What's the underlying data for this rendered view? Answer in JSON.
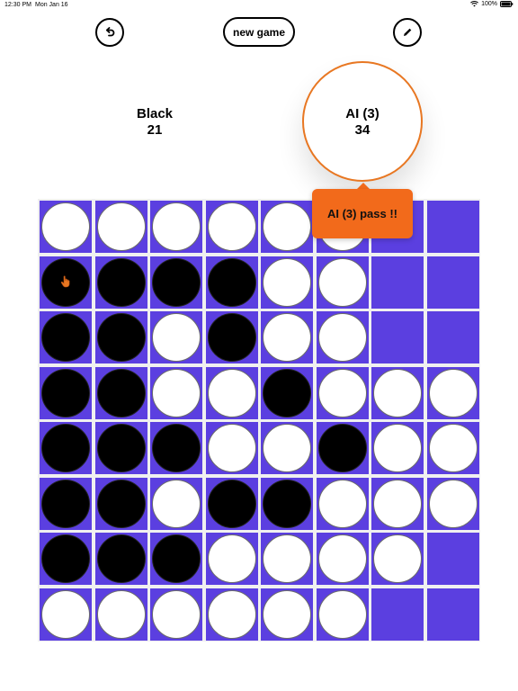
{
  "status_bar": {
    "time": "12:30 PM",
    "date": "Mon Jan 16",
    "battery": "100%"
  },
  "toolbar": {
    "new_game_label": "new game",
    "undo_icon": "undo-icon",
    "edit_icon": "pencil-icon"
  },
  "scores": {
    "black": {
      "name": "Black",
      "count": "21"
    },
    "ai": {
      "name": "AI (3)",
      "count": "34"
    }
  },
  "tooltip": {
    "text": "AI (3) pass !!"
  },
  "colors": {
    "board": "#5b3fe0",
    "accent": "#e87722",
    "tooltip": "#f26a1b"
  },
  "board": [
    [
      "W",
      "W",
      "W",
      "W",
      "W",
      "W",
      "",
      ""
    ],
    [
      "B",
      "B",
      "B",
      "B",
      "W",
      "W",
      "",
      ""
    ],
    [
      "B",
      "B",
      "W",
      "B",
      "W",
      "W",
      "",
      ""
    ],
    [
      "B",
      "B",
      "W",
      "W",
      "B",
      "W",
      "W",
      "W"
    ],
    [
      "B",
      "B",
      "B",
      "W",
      "W",
      "B",
      "W",
      "W"
    ],
    [
      "B",
      "B",
      "W",
      "B",
      "B",
      "W",
      "W",
      "W"
    ],
    [
      "B",
      "B",
      "B",
      "W",
      "W",
      "W",
      "W",
      ""
    ],
    [
      "W",
      "W",
      "W",
      "W",
      "W",
      "W",
      "",
      ""
    ]
  ]
}
